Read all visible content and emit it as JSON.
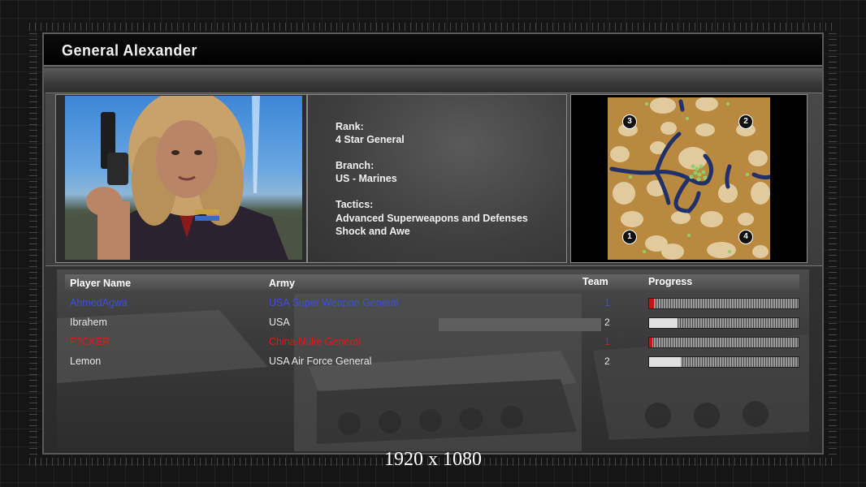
{
  "header": {
    "title": "General Alexander"
  },
  "general": {
    "rank_label": "Rank:",
    "rank_value": "4 Star General",
    "branch_label": "Branch:",
    "branch_value": "US - Marines",
    "tactics_label": "Tactics:",
    "tactics_value_1": "Advanced Superweapons and Defenses",
    "tactics_value_2": "Shock and Awe"
  },
  "minimap": {
    "start_positions": [
      "3",
      "2",
      "1",
      "4"
    ]
  },
  "lobby": {
    "columns": {
      "player": "Player Name",
      "army": "Army",
      "team": "Team",
      "progress": "Progress"
    },
    "players": [
      {
        "name": "AhmedAgwa",
        "army": "USA Super Weapon General",
        "team": "1",
        "color": "#3a4fe0",
        "progress": 0.03
      },
      {
        "name": "Ibrahem",
        "army": "USA",
        "team": "2",
        "color": "#e8e8e8",
        "progress": 0.19
      },
      {
        "name": "F?CKER",
        "army": "China Nuke General",
        "team": "1",
        "color": "#e01818",
        "progress": 0.02
      },
      {
        "name": "Lemon",
        "army": "USA Air Force General",
        "team": "2",
        "color": "#e8e8e8",
        "progress": 0.21
      }
    ]
  },
  "caption": "1920 x 1080",
  "colors": {
    "fill": "#e0e0e0",
    "fill_red": "#cc1111"
  }
}
